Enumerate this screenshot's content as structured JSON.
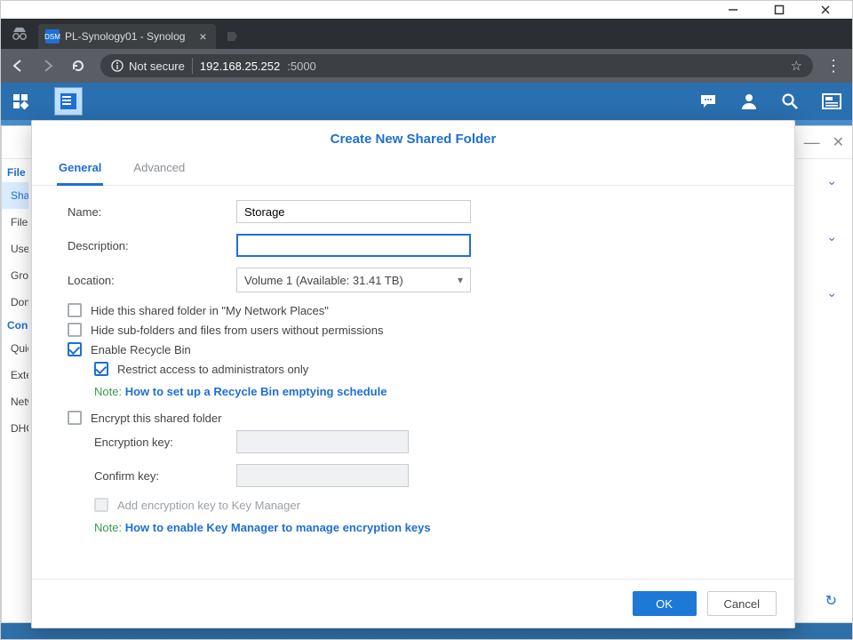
{
  "os": {
    "min": "—",
    "max": "☐",
    "close": "✕"
  },
  "browser": {
    "tab_title": "PL-Synology01 - Synolog",
    "favicon_text": "DSM",
    "not_secure_label": "Not secure",
    "url_main": "192.168.25.252",
    "url_port": ":5000"
  },
  "cp": {
    "headers": {
      "file_sharing": "File Sharing",
      "connectivity": "Connectivity"
    },
    "items": {
      "shared_folder": "Shared Folder",
      "file_services": "File Services",
      "user": "User",
      "group": "Group",
      "domain": "Domain/LDAP",
      "quickconnect": "QuickConnect",
      "external_access": "External Access",
      "network": "Network",
      "dhcp": "DHCP Server"
    },
    "toggle_icon": "⇄"
  },
  "modal": {
    "title": "Create New Shared Folder",
    "tabs": {
      "general": "General",
      "advanced": "Advanced"
    },
    "labels": {
      "name": "Name:",
      "description": "Description:",
      "location": "Location:",
      "encryption_key": "Encryption key:",
      "confirm_key": "Confirm key:"
    },
    "values": {
      "name": "Storage",
      "description": "",
      "location": "Volume 1 (Available: 31.41 TB)"
    },
    "checkboxes": {
      "hide_network": "Hide this shared folder in \"My Network Places\"",
      "hide_subfolders": "Hide sub-folders and files from users without permissions",
      "enable_recycle": "Enable Recycle Bin",
      "restrict_admins": "Restrict access to administrators only",
      "encrypt": "Encrypt this shared folder",
      "add_key_manager": "Add encryption key to Key Manager"
    },
    "notes": {
      "label": "Note:",
      "recycle_link": "How to set up a Recycle Bin emptying schedule",
      "key_manager_link": "How to enable Key Manager to manage encryption keys"
    },
    "buttons": {
      "ok": "OK",
      "cancel": "Cancel"
    }
  }
}
